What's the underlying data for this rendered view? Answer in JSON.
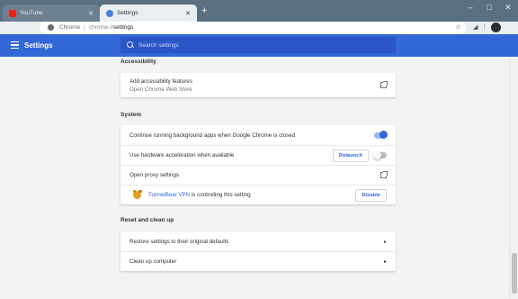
{
  "browser": {
    "tabs": [
      {
        "title": "YouTube",
        "active": false,
        "icon": "youtube-icon"
      },
      {
        "title": "Settings",
        "active": true,
        "icon": "settings-gear-icon"
      }
    ],
    "address": {
      "site_label": "Chrome",
      "url_scheme": "chrome://",
      "url_path": "settings"
    }
  },
  "header": {
    "title": "Settings",
    "search_placeholder": "Search settings",
    "accent_color": "#3367d6"
  },
  "accessibility": {
    "section_title": "Accessibility",
    "item_title": "Add accessibility features",
    "item_subtitle": "Open Chrome Web Store"
  },
  "system": {
    "section_title": "System",
    "background_apps_label": "Continue running background apps when Google Chrome is closed",
    "background_apps_on": true,
    "hw_accel_label": "Use hardware acceleration when available",
    "hw_accel_on": false,
    "relaunch_label": "Relaunch",
    "proxy_label": "Open proxy settings",
    "extension_name": "TunnelBear VPN",
    "extension_text": " is controlling this setting",
    "disable_label": "Disable"
  },
  "reset": {
    "section_title": "Reset and clean up",
    "restore_label": "Restore settings to their original defaults",
    "cleanup_label": "Clean up computer"
  }
}
